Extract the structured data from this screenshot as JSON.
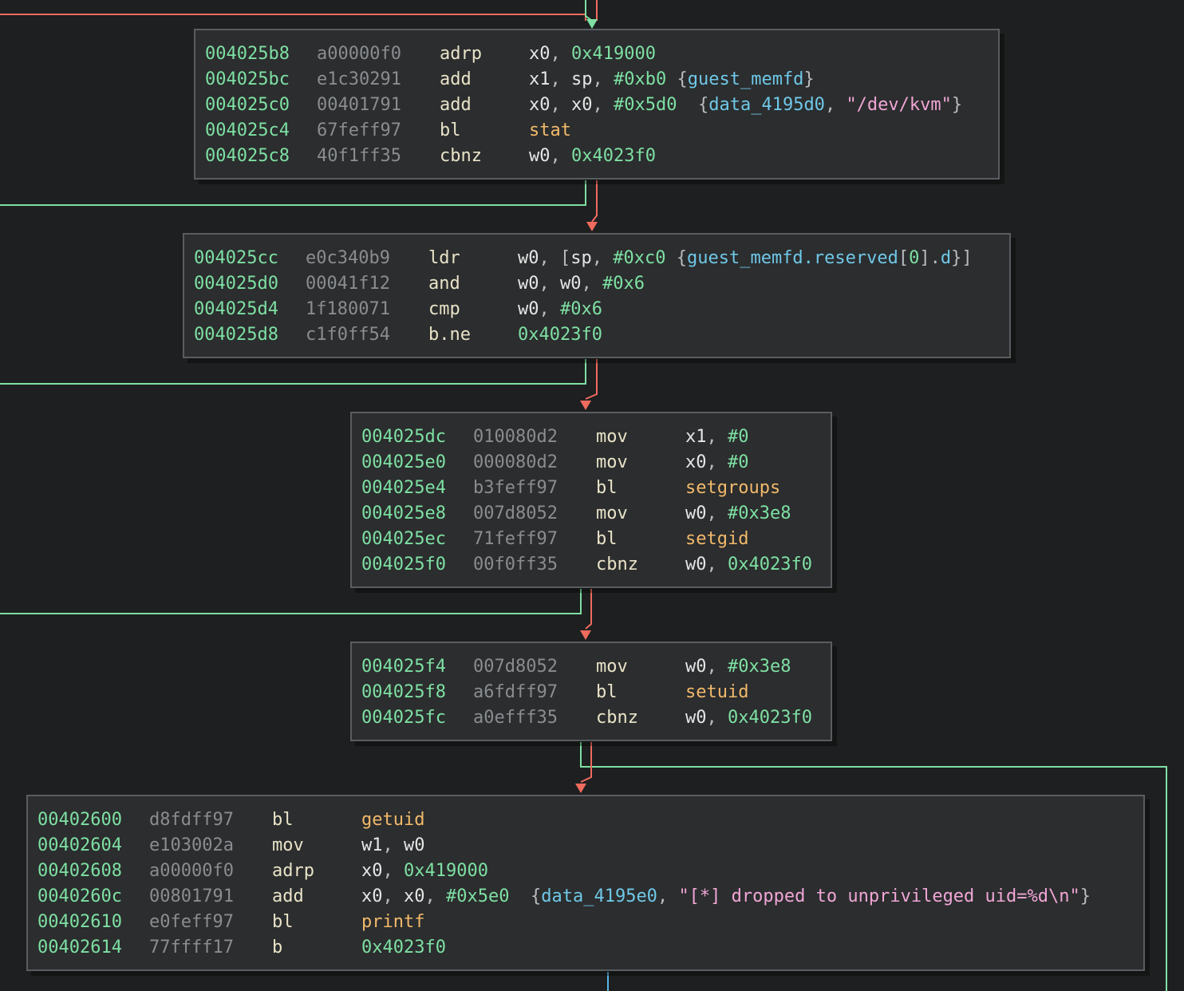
{
  "colors": {
    "background": "#1e1f20",
    "block_bg": "#2b2d2e",
    "block_border": "#5a5d60",
    "address": "#7ee0a3",
    "bytes": "#8a8d90",
    "mnemonic": "#e9e3c8",
    "register": "#e6e6e6",
    "immediate": "#7ee0a3",
    "symbol": "#f2b96b",
    "variable": "#6fc8e8",
    "string": "#f0a6d6",
    "edge_true": "#7ee0a3",
    "edge_false": "#ef6b5e",
    "edge_jump": "#5ab4e6"
  },
  "blocks": [
    {
      "lines": [
        {
          "addr": "004025b8",
          "bytes": "a00000f0",
          "mn": "adrp",
          "ops": [
            [
              "reg",
              "x0"
            ],
            [
              "pun",
              ", "
            ],
            [
              "imm",
              "0x419000"
            ]
          ]
        },
        {
          "addr": "004025bc",
          "bytes": "e1c30291",
          "mn": "add",
          "ops": [
            [
              "reg",
              "x1"
            ],
            [
              "pun",
              ", "
            ],
            [
              "reg",
              "sp"
            ],
            [
              "pun",
              ", "
            ],
            [
              "imm",
              "#0xb0"
            ],
            [
              "pun",
              " {"
            ],
            [
              "var",
              "guest_memfd"
            ],
            [
              "pun",
              "}"
            ]
          ]
        },
        {
          "addr": "004025c0",
          "bytes": "00401791",
          "mn": "add",
          "ops": [
            [
              "reg",
              "x0"
            ],
            [
              "pun",
              ", "
            ],
            [
              "reg",
              "x0"
            ],
            [
              "pun",
              ", "
            ],
            [
              "imm",
              "#0x5d0"
            ],
            [
              "pun",
              "  {"
            ],
            [
              "var",
              "data_4195d0"
            ],
            [
              "pun",
              ", "
            ],
            [
              "str",
              "\"/dev/kvm\""
            ],
            [
              "pun",
              "}"
            ]
          ]
        },
        {
          "addr": "004025c4",
          "bytes": "67feff97",
          "mn": "bl",
          "ops": [
            [
              "sym",
              "stat"
            ]
          ]
        },
        {
          "addr": "004025c8",
          "bytes": "40f1ff35",
          "mn": "cbnz",
          "ops": [
            [
              "reg",
              "w0"
            ],
            [
              "pun",
              ", "
            ],
            [
              "imm",
              "0x4023f0"
            ]
          ]
        }
      ]
    },
    {
      "lines": [
        {
          "addr": "004025cc",
          "bytes": "e0c340b9",
          "mn": "ldr",
          "ops": [
            [
              "reg",
              "w0"
            ],
            [
              "pun",
              ", ["
            ],
            [
              "reg",
              "sp"
            ],
            [
              "pun",
              ", "
            ],
            [
              "imm",
              "#0xc0"
            ],
            [
              "pun",
              " {"
            ],
            [
              "var",
              "guest_memfd.reserved"
            ],
            [
              "pun",
              "["
            ],
            [
              "imm",
              "0"
            ],
            [
              "pun",
              "]."
            ],
            [
              "var",
              "d"
            ],
            [
              "pun",
              "}]"
            ]
          ]
        },
        {
          "addr": "004025d0",
          "bytes": "00041f12",
          "mn": "and",
          "ops": [
            [
              "reg",
              "w0"
            ],
            [
              "pun",
              ", "
            ],
            [
              "reg",
              "w0"
            ],
            [
              "pun",
              ", "
            ],
            [
              "imm",
              "#0x6"
            ]
          ]
        },
        {
          "addr": "004025d4",
          "bytes": "1f180071",
          "mn": "cmp",
          "ops": [
            [
              "reg",
              "w0"
            ],
            [
              "pun",
              ", "
            ],
            [
              "imm",
              "#0x6"
            ]
          ]
        },
        {
          "addr": "004025d8",
          "bytes": "c1f0ff54",
          "mn": "b.ne",
          "ops": [
            [
              "imm",
              "0x4023f0"
            ]
          ]
        }
      ]
    },
    {
      "lines": [
        {
          "addr": "004025dc",
          "bytes": "010080d2",
          "mn": "mov",
          "ops": [
            [
              "reg",
              "x1"
            ],
            [
              "pun",
              ", "
            ],
            [
              "imm",
              "#0"
            ]
          ]
        },
        {
          "addr": "004025e0",
          "bytes": "000080d2",
          "mn": "mov",
          "ops": [
            [
              "reg",
              "x0"
            ],
            [
              "pun",
              ", "
            ],
            [
              "imm",
              "#0"
            ]
          ]
        },
        {
          "addr": "004025e4",
          "bytes": "b3feff97",
          "mn": "bl",
          "ops": [
            [
              "sym",
              "setgroups"
            ]
          ]
        },
        {
          "addr": "004025e8",
          "bytes": "007d8052",
          "mn": "mov",
          "ops": [
            [
              "reg",
              "w0"
            ],
            [
              "pun",
              ", "
            ],
            [
              "imm",
              "#0x3e8"
            ]
          ]
        },
        {
          "addr": "004025ec",
          "bytes": "71feff97",
          "mn": "bl",
          "ops": [
            [
              "sym",
              "setgid"
            ]
          ]
        },
        {
          "addr": "004025f0",
          "bytes": "00f0ff35",
          "mn": "cbnz",
          "ops": [
            [
              "reg",
              "w0"
            ],
            [
              "pun",
              ", "
            ],
            [
              "imm",
              "0x4023f0"
            ]
          ]
        }
      ]
    },
    {
      "lines": [
        {
          "addr": "004025f4",
          "bytes": "007d8052",
          "mn": "mov",
          "ops": [
            [
              "reg",
              "w0"
            ],
            [
              "pun",
              ", "
            ],
            [
              "imm",
              "#0x3e8"
            ]
          ]
        },
        {
          "addr": "004025f8",
          "bytes": "a6fdff97",
          "mn": "bl",
          "ops": [
            [
              "sym",
              "setuid"
            ]
          ]
        },
        {
          "addr": "004025fc",
          "bytes": "a0efff35",
          "mn": "cbnz",
          "ops": [
            [
              "reg",
              "w0"
            ],
            [
              "pun",
              ", "
            ],
            [
              "imm",
              "0x4023f0"
            ]
          ]
        }
      ]
    },
    {
      "lines": [
        {
          "addr": "00402600",
          "bytes": "d8fdff97",
          "mn": "bl",
          "ops": [
            [
              "sym",
              "getuid"
            ]
          ]
        },
        {
          "addr": "00402604",
          "bytes": "e103002a",
          "mn": "mov",
          "ops": [
            [
              "reg",
              "w1"
            ],
            [
              "pun",
              ", "
            ],
            [
              "reg",
              "w0"
            ]
          ]
        },
        {
          "addr": "00402608",
          "bytes": "a00000f0",
          "mn": "adrp",
          "ops": [
            [
              "reg",
              "x0"
            ],
            [
              "pun",
              ", "
            ],
            [
              "imm",
              "0x419000"
            ]
          ]
        },
        {
          "addr": "0040260c",
          "bytes": "00801791",
          "mn": "add",
          "ops": [
            [
              "reg",
              "x0"
            ],
            [
              "pun",
              ", "
            ],
            [
              "reg",
              "x0"
            ],
            [
              "pun",
              ", "
            ],
            [
              "imm",
              "#0x5e0"
            ],
            [
              "pun",
              "  {"
            ],
            [
              "var",
              "data_4195e0"
            ],
            [
              "pun",
              ", "
            ],
            [
              "str",
              "\"[*] dropped to unprivileged uid=%d\\n\""
            ],
            [
              "pun",
              "}"
            ]
          ]
        },
        {
          "addr": "00402610",
          "bytes": "e0feff97",
          "mn": "bl",
          "ops": [
            [
              "sym",
              "printf"
            ]
          ]
        },
        {
          "addr": "00402614",
          "bytes": "77ffff17",
          "mn": "b",
          "ops": [
            [
              "imm",
              "0x4023f0"
            ]
          ]
        }
      ]
    }
  ]
}
